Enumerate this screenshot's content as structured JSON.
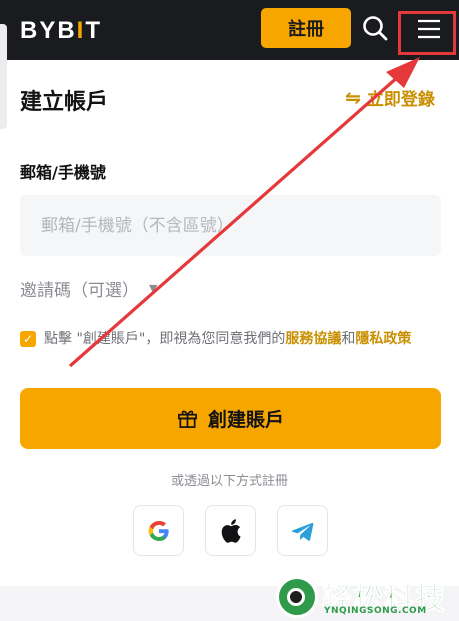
{
  "header": {
    "logo_prefix": "BYB",
    "logo_accent": "I",
    "logo_suffix": "T",
    "register_label": "註冊"
  },
  "card": {
    "title": "建立帳戶",
    "login_link": "立即登錄",
    "email_label": "郵箱/手機號",
    "email_placeholder": "郵箱/手機號（不含區號）",
    "referral_label": "邀請碼（可選）",
    "agree_prefix": "點擊 \"創建賬戶\"，即視為您同意我們的",
    "terms_link": "服務協議",
    "agree_and": "和",
    "privacy_link": "隱私政策",
    "create_button": "創建賬戶",
    "alt_methods": "或透過以下方式註冊"
  },
  "social": [
    "google-logo",
    "apple-logo",
    "telegram-logo"
  ],
  "watermark": {
    "name": "轻松科技",
    "url": "YNQINGSONG.COM"
  },
  "colors": {
    "brand": "#f7a600",
    "header_bg": "#1a1b1e",
    "link": "#c98f00",
    "annotation": "#e5383b"
  }
}
